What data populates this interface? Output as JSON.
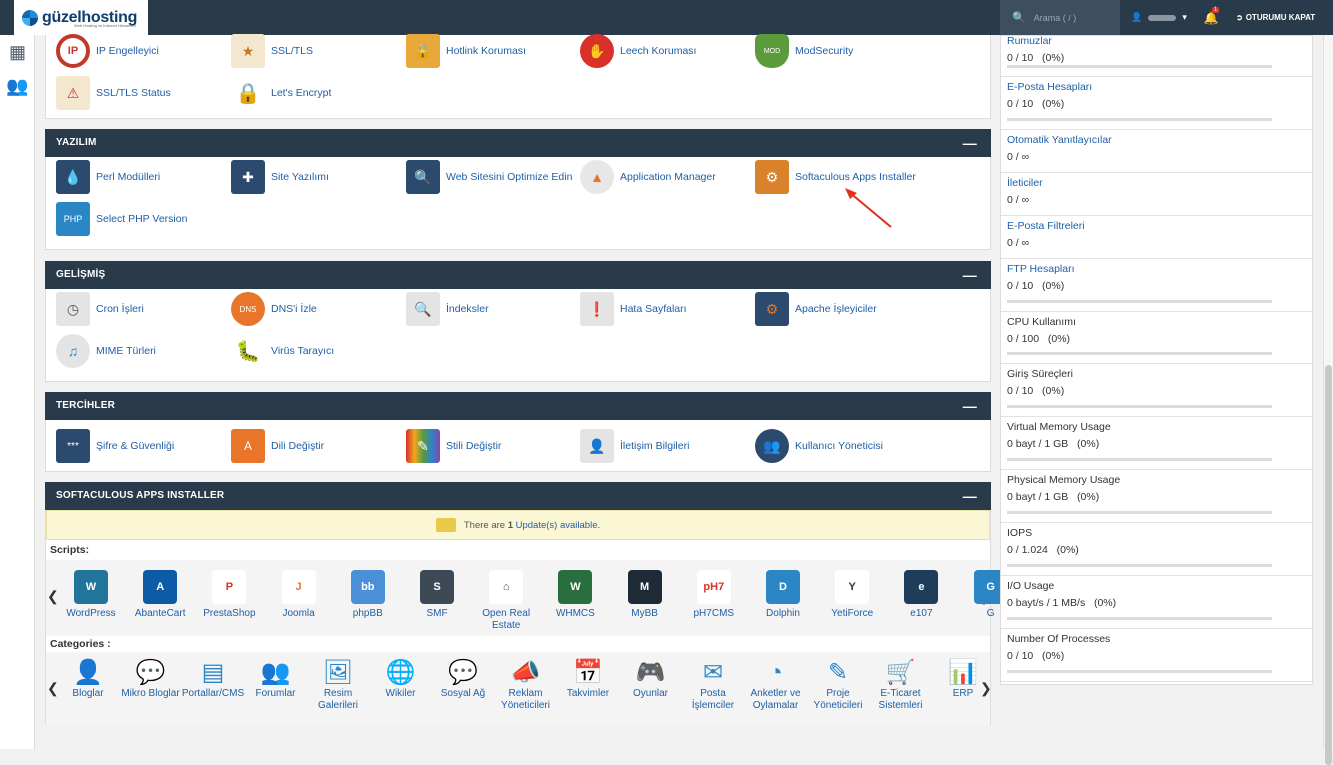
{
  "topbar": {
    "logo_text": "güzelhosting",
    "logo_sub": "Web Hosting ve İnternet Hizmetleri",
    "search_placeholder": "Arama ( / )",
    "notification_count": "1",
    "logout_label": "OTURUMU KAPAT"
  },
  "sections": {
    "security_row1": [
      "IP Engelleyici",
      "SSL/TLS",
      "Hotlink Koruması",
      "Leech Koruması",
      "ModSecurity"
    ],
    "security_row2": [
      "SSL/TLS Status",
      "Let's Encrypt"
    ],
    "software": {
      "title": "YAZILIM",
      "row1": [
        "Perl Modülleri",
        "Site Yazılımı",
        "Web Sitesini Optimize Edin",
        "Application Manager",
        "Softaculous Apps Installer"
      ],
      "row2": [
        "Select PHP Version"
      ]
    },
    "advanced": {
      "title": "GELİŞMİŞ",
      "row1": [
        "Cron İşleri",
        "DNS'i İzle",
        "İndeksler",
        "Hata Sayfaları",
        "Apache İşleyiciler"
      ],
      "row2": [
        "MIME Türleri",
        "Virüs Tarayıcı"
      ]
    },
    "preferences": {
      "title": "TERCİHLER",
      "row1": [
        "Şifre & Güvenliği",
        "Dili Değiştir",
        "Stili Değiştir",
        "İletişim Bilgileri",
        "Kullanıcı Yöneticisi"
      ]
    },
    "softaculous": {
      "title": "SOFTACULOUS APPS INSTALLER",
      "notice_pre": "There are",
      "notice_count": "1",
      "notice_post": "Update(s) available.",
      "scripts_label": "Scripts:",
      "scripts": [
        "WordPress",
        "AbanteCart",
        "PrestaShop",
        "Joomla",
        "phpBB",
        "SMF",
        "Open Real Estate",
        "WHMCS",
        "MyBB",
        "pH7CMS",
        "Dolphin",
        "YetiForce",
        "e107",
        "G"
      ],
      "script_icons": [
        "W",
        "A",
        "P",
        "J",
        "bb",
        "S",
        "⌂",
        "W",
        "M",
        "pH7",
        "D",
        "Y",
        "e",
        "G"
      ],
      "categories_label": "Categories :",
      "categories": [
        "Bloglar",
        "Mikro Bloglar",
        "Portallar/CMS",
        "Forumlar",
        "Resim Galerileri",
        "Wikiler",
        "Sosyal Ağ",
        "Reklam Yöneticileri",
        "Takvimler",
        "Oyunlar",
        "Posta İşlemciler",
        "Anketler ve Oylamalar",
        "Proje Yöneticileri",
        "E-Ticaret Sistemleri",
        "ERP"
      ]
    }
  },
  "stats": [
    {
      "title": "Rumuzlar",
      "value": "0 / 10   (0%)",
      "bar": true
    },
    {
      "title": "E-Posta Hesapları",
      "value": "0 / 10   (0%)",
      "bar": true
    },
    {
      "title": "Otomatik Yanıtlayıcılar",
      "value": "0 / ∞",
      "bar": false
    },
    {
      "title": "İleticiler",
      "value": "0 / ∞",
      "bar": false
    },
    {
      "title": "E-Posta Filtreleri",
      "value": "0 / ∞",
      "bar": false
    },
    {
      "title": "FTP Hesapları",
      "value": "0 / 10   (0%)",
      "bar": true
    },
    {
      "title": "CPU Kullanımı",
      "value": "0 / 100   (0%)",
      "bar": true
    },
    {
      "title": "Giriş Süreçleri",
      "value": "0 / 10   (0%)",
      "bar": true
    },
    {
      "title": "Virtual Memory Usage",
      "value": "0 bayt / 1 GB   (0%)",
      "bar": true
    },
    {
      "title": "Physical Memory Usage",
      "value": "0 bayt / 1 GB   (0%)",
      "bar": true
    },
    {
      "title": "IOPS",
      "value": "0 / 1.024   (0%)",
      "bar": true
    },
    {
      "title": "I/O Usage",
      "value": "0 bayt/s / 1 MB/s   (0%)",
      "bar": true
    },
    {
      "title": "Number Of Processes",
      "value": "0 / 10   (0%)",
      "bar": true
    }
  ],
  "colors": {
    "header": "#293a4a",
    "link": "#1f5fa6",
    "accent": "#2b86c6",
    "arrow": "#e0301e"
  }
}
